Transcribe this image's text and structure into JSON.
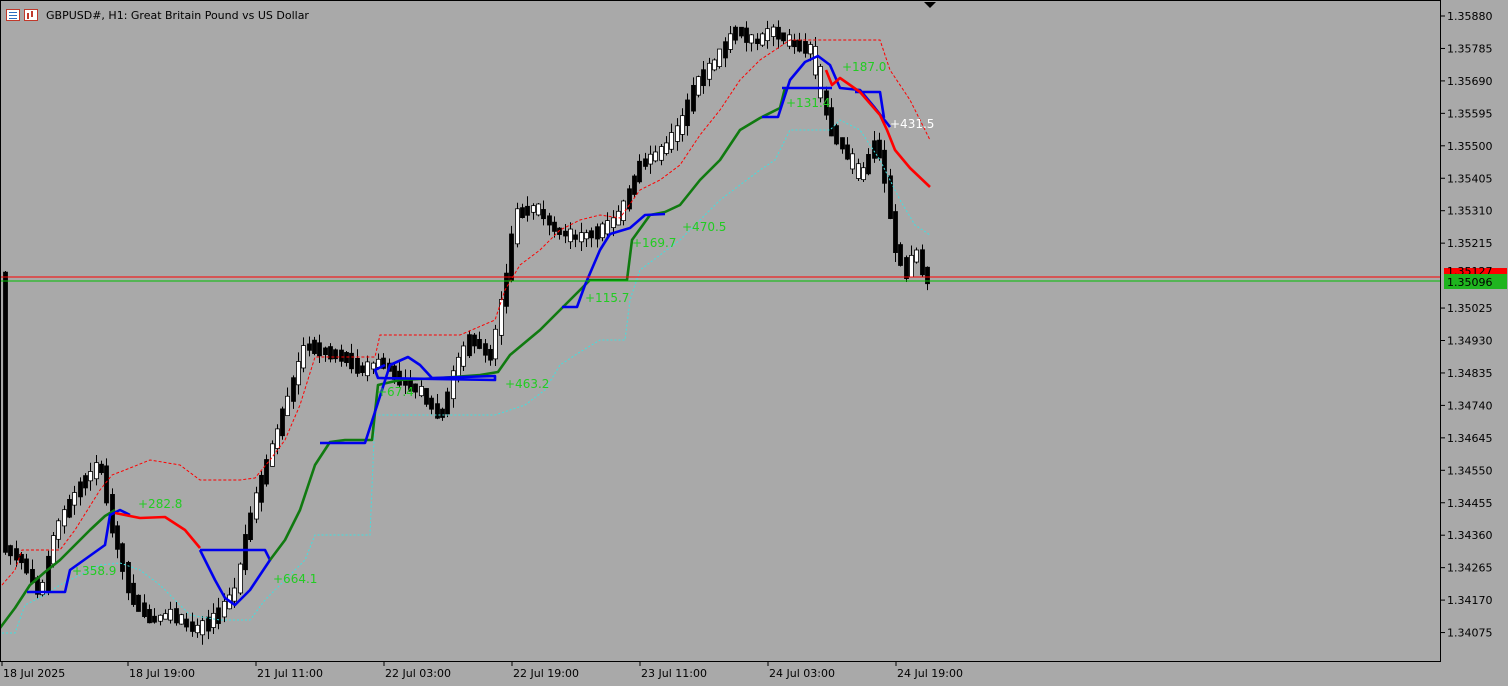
{
  "window": {
    "title": "GBPUSD#, H1:  Great Britain Pound vs US Dollar",
    "icons": [
      "list-icon",
      "chart-icon"
    ]
  },
  "price_axis": {
    "labels": [
      "1.35880",
      "1.35785",
      "1.35690",
      "1.35595",
      "1.35500",
      "1.35405",
      "1.35310",
      "1.35215",
      "1.35025",
      "1.34930",
      "1.34835",
      "1.34740",
      "1.34645",
      "1.34550",
      "1.34455",
      "1.34360",
      "1.34265",
      "1.34170",
      "1.34075"
    ],
    "current_bid": "1.35096",
    "current_ask_label": "1.35127"
  },
  "time_axis": {
    "labels": [
      "18 Jul 2025",
      "18 Jul 19:00",
      "21 Jul 11:00",
      "22 Jul 03:00",
      "22 Jul 19:00",
      "23 Jul 11:00",
      "24 Jul 03:00",
      "24 Jul 19:00"
    ]
  },
  "signals": [
    {
      "text": "+358.9",
      "color": "#22cc22"
    },
    {
      "text": "+282.8",
      "color": "#22cc22"
    },
    {
      "text": "+664.1",
      "color": "#22cc22"
    },
    {
      "text": "+67.4",
      "color": "#22cc22"
    },
    {
      "text": "+463.2",
      "color": "#22cc22"
    },
    {
      "text": "+115.7",
      "color": "#22cc22"
    },
    {
      "text": "+169.7",
      "color": "#22cc22"
    },
    {
      "text": "+470.5",
      "color": "#22cc22"
    },
    {
      "text": "+131.4",
      "color": "#22cc22"
    },
    {
      "text": "+187.0",
      "color": "#22cc22"
    },
    {
      "text": "+431.5",
      "color": "#ffffff"
    }
  ],
  "colors": {
    "background": "#a9a9a9",
    "bull_candle": "#ffffff",
    "bear_candle": "#000000",
    "trend_up": "#107a10",
    "trend_down": "#ff0000",
    "trend_flat": "#0000ee",
    "upper_band": "#ff0000",
    "lower_band": "#40e0e0",
    "ask_line": "#ff0000",
    "bid_line": "#00c000"
  }
}
